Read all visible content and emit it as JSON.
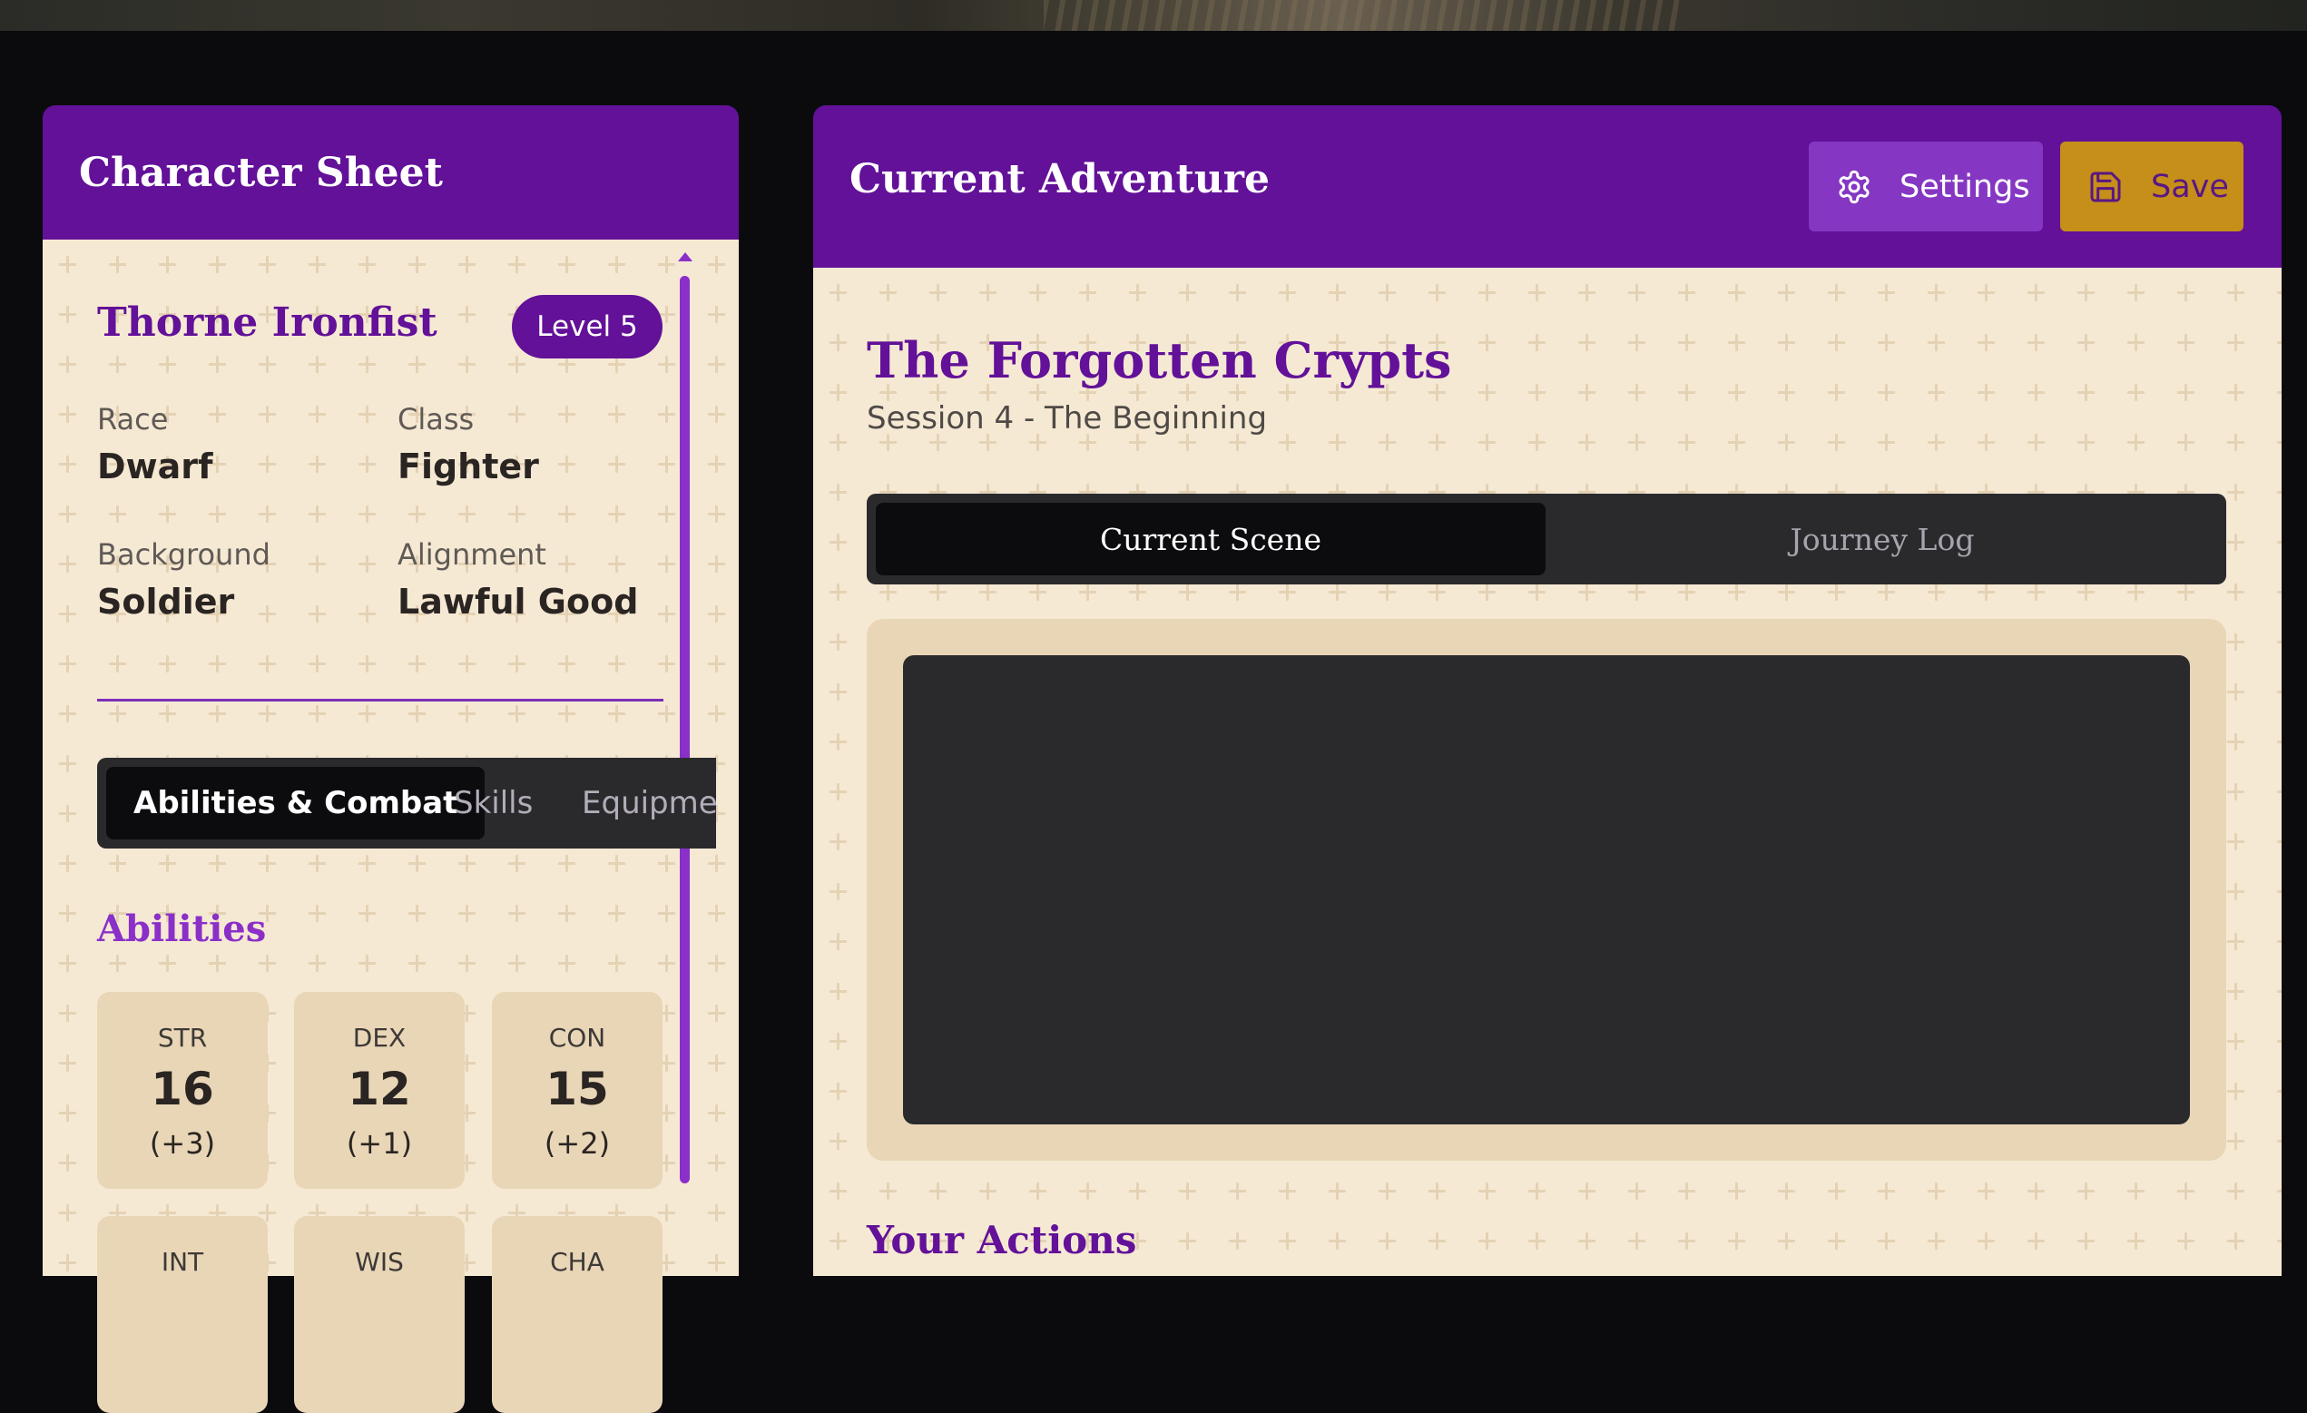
{
  "character_panel": {
    "title": "Character Sheet",
    "name": "Thorne Ironfist",
    "level": "Level 5",
    "fields": [
      {
        "label": "Race",
        "value": "Dwarf"
      },
      {
        "label": "Class",
        "value": "Fighter"
      },
      {
        "label": "Background",
        "value": "Soldier"
      },
      {
        "label": "Alignment",
        "value": "Lawful Good"
      }
    ],
    "tabs": [
      {
        "label": "Abilities & Combat",
        "active": true
      },
      {
        "label": "Skills",
        "active": false
      },
      {
        "label": "Equipmen",
        "active": false
      }
    ],
    "abilities_heading": "Abilities",
    "abilities": [
      {
        "abbr": "STR",
        "score": "16",
        "mod": "(+3)"
      },
      {
        "abbr": "DEX",
        "score": "12",
        "mod": "(+1)"
      },
      {
        "abbr": "CON",
        "score": "15",
        "mod": "(+2)"
      },
      {
        "abbr": "INT",
        "score": "",
        "mod": ""
      },
      {
        "abbr": "WIS",
        "score": "",
        "mod": ""
      },
      {
        "abbr": "CHA",
        "score": "",
        "mod": ""
      }
    ]
  },
  "adventure_panel": {
    "title": "Current Adventure",
    "settings_label": "Settings",
    "save_label": "Save",
    "adventure_title": "The Forgotten Crypts",
    "session": "Session 4 - The Beginning",
    "tabs": [
      {
        "label": "Current Scene",
        "active": true
      },
      {
        "label": "Journey Log",
        "active": false
      }
    ],
    "actions_heading": "Your Actions"
  },
  "colors": {
    "primary": "#621198",
    "accent": "#8a2fc8",
    "gold": "#c58f19",
    "parchment": "#f6e9d4",
    "card": "#e9d6b7"
  },
  "icons": {
    "settings": "gear-icon",
    "save": "save-icon"
  }
}
